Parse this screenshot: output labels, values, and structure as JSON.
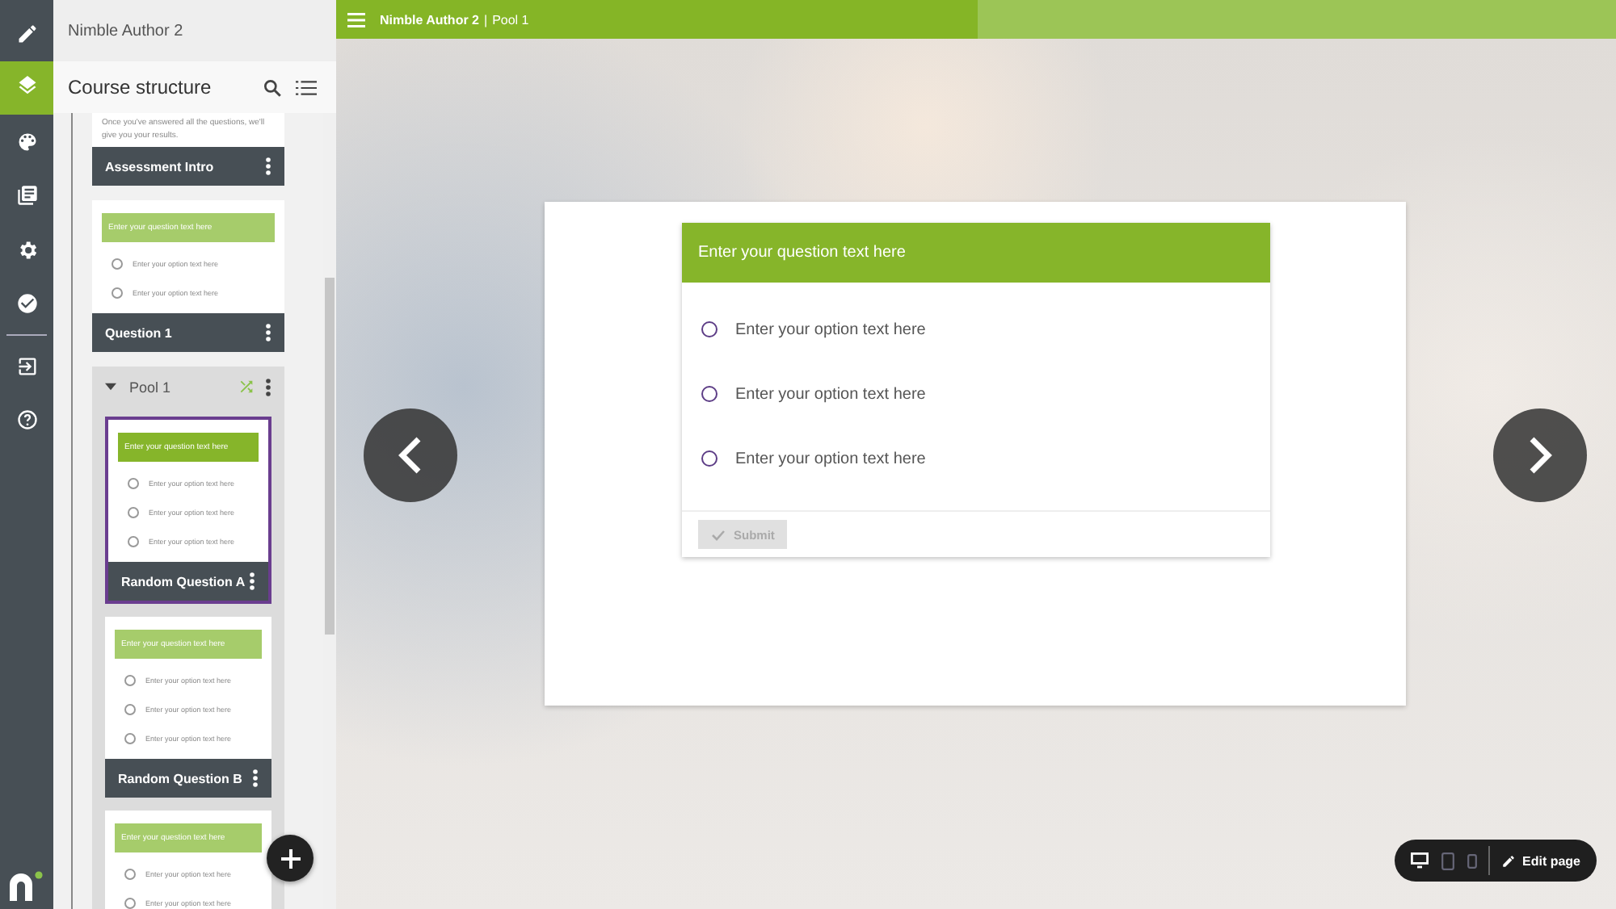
{
  "rail": [
    {
      "kind": "pencil",
      "selected": false
    },
    {
      "kind": "layers",
      "selected": true
    },
    {
      "kind": "palette",
      "selected": false
    },
    {
      "kind": "library",
      "selected": false
    },
    {
      "kind": "gear",
      "selected": false
    },
    {
      "kind": "check",
      "selected": false
    },
    {
      "kind": "exit",
      "selected": false
    },
    {
      "kind": "help",
      "selected": false
    }
  ],
  "panel": {
    "app_title": "Nimble Author 2",
    "title": "Course structure"
  },
  "tree": [
    {
      "kind": "text",
      "intro": "Once you've answered all the questions, we'll give you your results.",
      "title": "Assessment Intro",
      "selected": false
    },
    {
      "kind": "question",
      "question": "Enter your question text here",
      "options": [
        "Enter your option text here",
        "Enter your option text here"
      ],
      "title": "Question 1",
      "selected": false
    },
    {
      "kind": "pool",
      "title": "Pool 1",
      "expanded": true,
      "children": [
        {
          "kind": "question",
          "question": "Enter your question text here",
          "options": [
            "Enter your option text here",
            "Enter your option text here",
            "Enter your option text here"
          ],
          "title": "Random Question A",
          "selected": true
        },
        {
          "kind": "question",
          "question": "Enter your question text here",
          "options": [
            "Enter your option text here",
            "Enter your option text here",
            "Enter your option text here"
          ],
          "title": "Random Question B",
          "selected": false
        },
        {
          "kind": "question",
          "question": "Enter your question text here",
          "options": [
            "Enter your option text here",
            "Enter your option text here"
          ],
          "selected": false
        }
      ]
    }
  ],
  "topbar": {
    "title": "Nimble Author 2",
    "separator": "|",
    "page": "Pool 1"
  },
  "question": {
    "title": "Enter your question text here",
    "options": [
      {
        "label": "Enter your option text here",
        "selected": false
      },
      {
        "label": "Enter your option text here",
        "selected": false
      },
      {
        "label": "Enter your option text here",
        "selected": false
      }
    ],
    "submit": {
      "label": "Submit",
      "disabled": true
    }
  },
  "toolbar": {
    "devices": [
      {
        "kind": "desktop",
        "selected": true
      },
      {
        "kind": "tablet",
        "selected": false
      },
      {
        "kind": "phone",
        "selected": false
      }
    ],
    "edit_label": "Edit page"
  }
}
